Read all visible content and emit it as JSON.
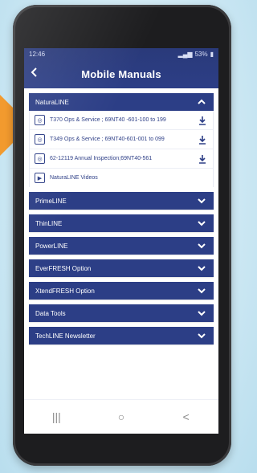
{
  "status": {
    "time": "12:46",
    "battery": "53%"
  },
  "header": {
    "title": "Mobile Manuals"
  },
  "sections": [
    {
      "label": "NaturaLINE",
      "expanded": true,
      "items": [
        {
          "label": "T370 Ops & Service ; 69NT40 -601-100 to 199",
          "icon": "document-icon",
          "download": true
        },
        {
          "label": "T349 Ops & Service ; 69NT40-601-001 to 099",
          "icon": "document-icon",
          "download": true
        },
        {
          "label": "62-12119 Annual Inspection;69NT40-561",
          "icon": "document-icon",
          "download": true
        },
        {
          "label": "NaturaLINE Videos",
          "icon": "video-icon",
          "download": false
        }
      ]
    },
    {
      "label": "PrimeLINE",
      "expanded": false
    },
    {
      "label": "ThinLINE",
      "expanded": false
    },
    {
      "label": "PowerLINE",
      "expanded": false
    },
    {
      "label": "EverFRESH Option",
      "expanded": false
    },
    {
      "label": "XtendFRESH Option",
      "expanded": false
    },
    {
      "label": "Data Tools",
      "expanded": false
    },
    {
      "label": "TechLINE Newsletter",
      "expanded": false
    }
  ],
  "navbar": {
    "recents": "|||",
    "home": "○",
    "back": "<"
  }
}
